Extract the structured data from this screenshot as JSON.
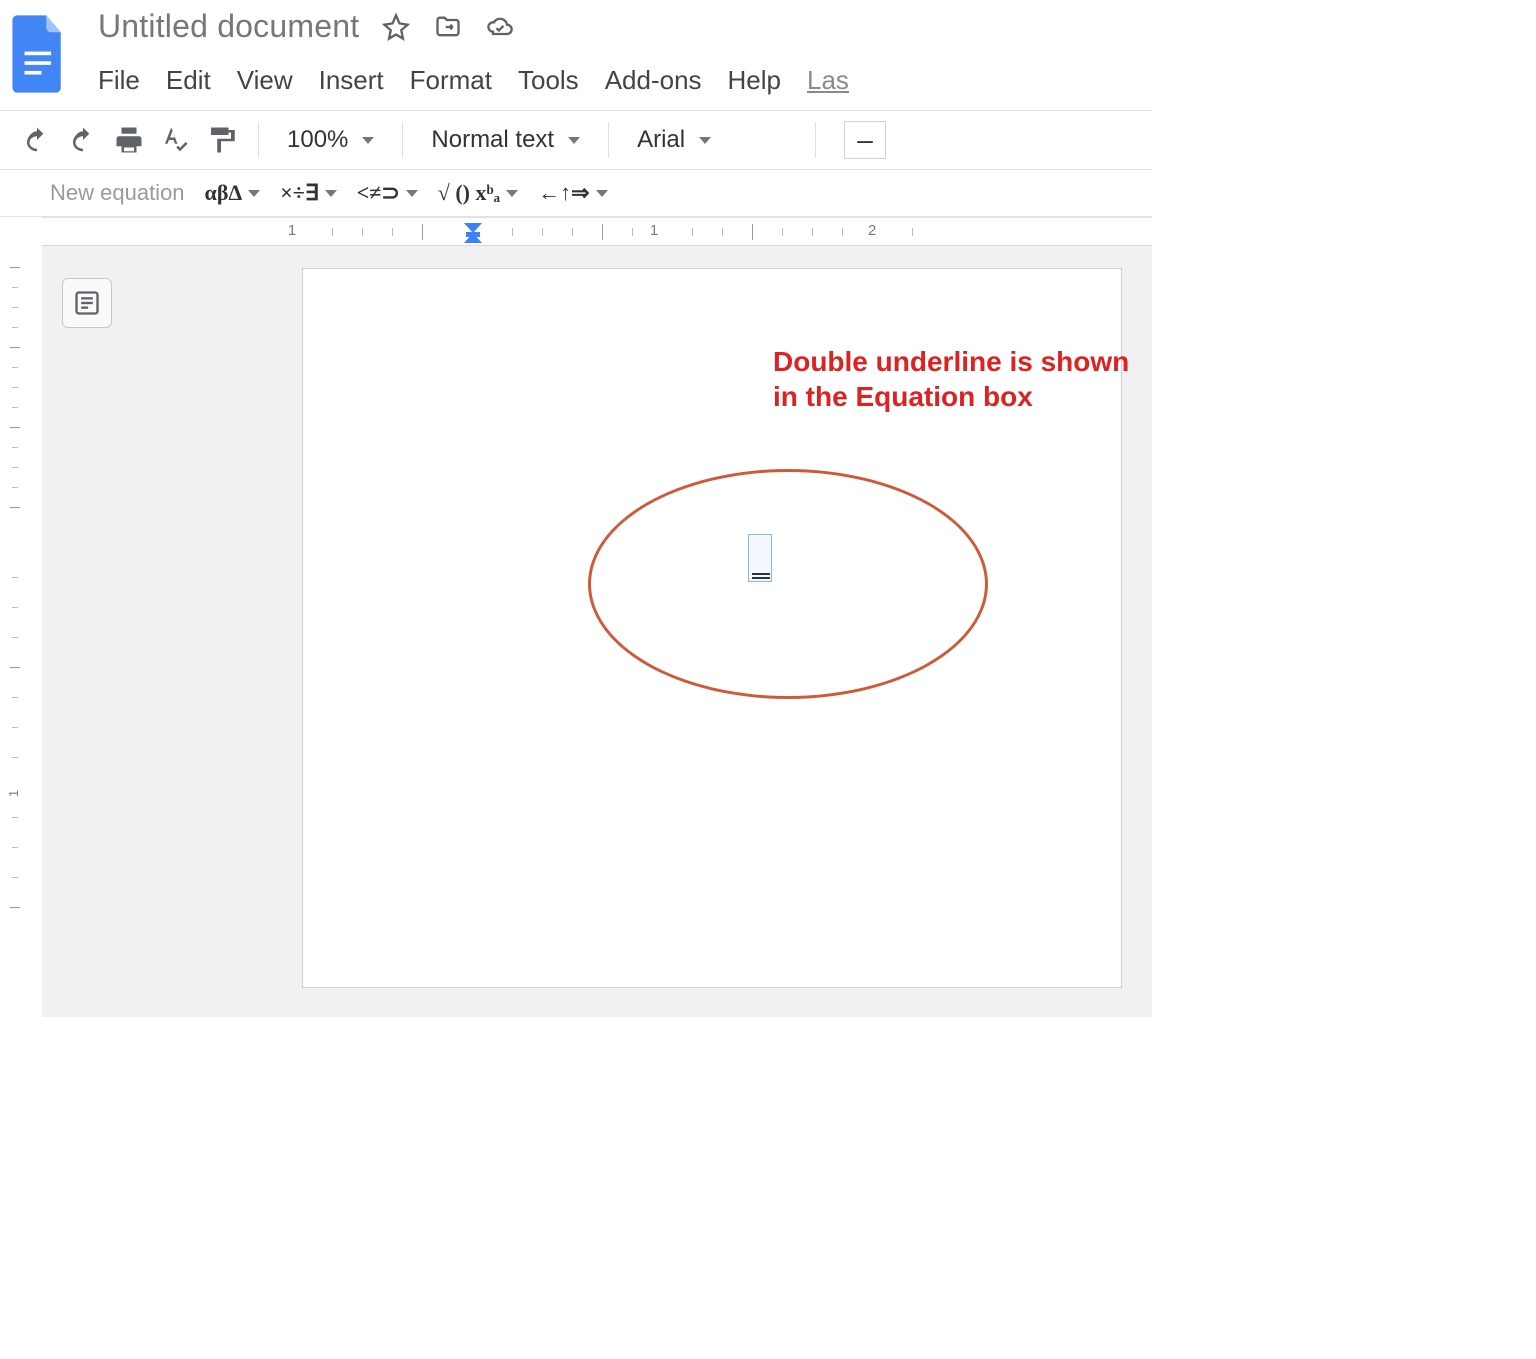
{
  "header": {
    "title": "Untitled document",
    "menus": [
      "File",
      "Edit",
      "View",
      "Insert",
      "Format",
      "Tools",
      "Add-ons",
      "Help"
    ],
    "last_edit": "Las"
  },
  "toolbar": {
    "zoom": "100%",
    "style": "Normal text",
    "font": "Arial"
  },
  "equation_toolbar": {
    "new_label": "New equation",
    "greek": "αβΔ",
    "ops": "×÷∃",
    "rel": "<≠⊃",
    "fns": "√ () xᵇₐ",
    "arrows": "←↑⇒"
  },
  "annotation": {
    "text": "Double underline is shown in the Equation box"
  },
  "ruler": {
    "h_numbers": [
      "1",
      "1",
      "2"
    ],
    "v_number": "1"
  }
}
